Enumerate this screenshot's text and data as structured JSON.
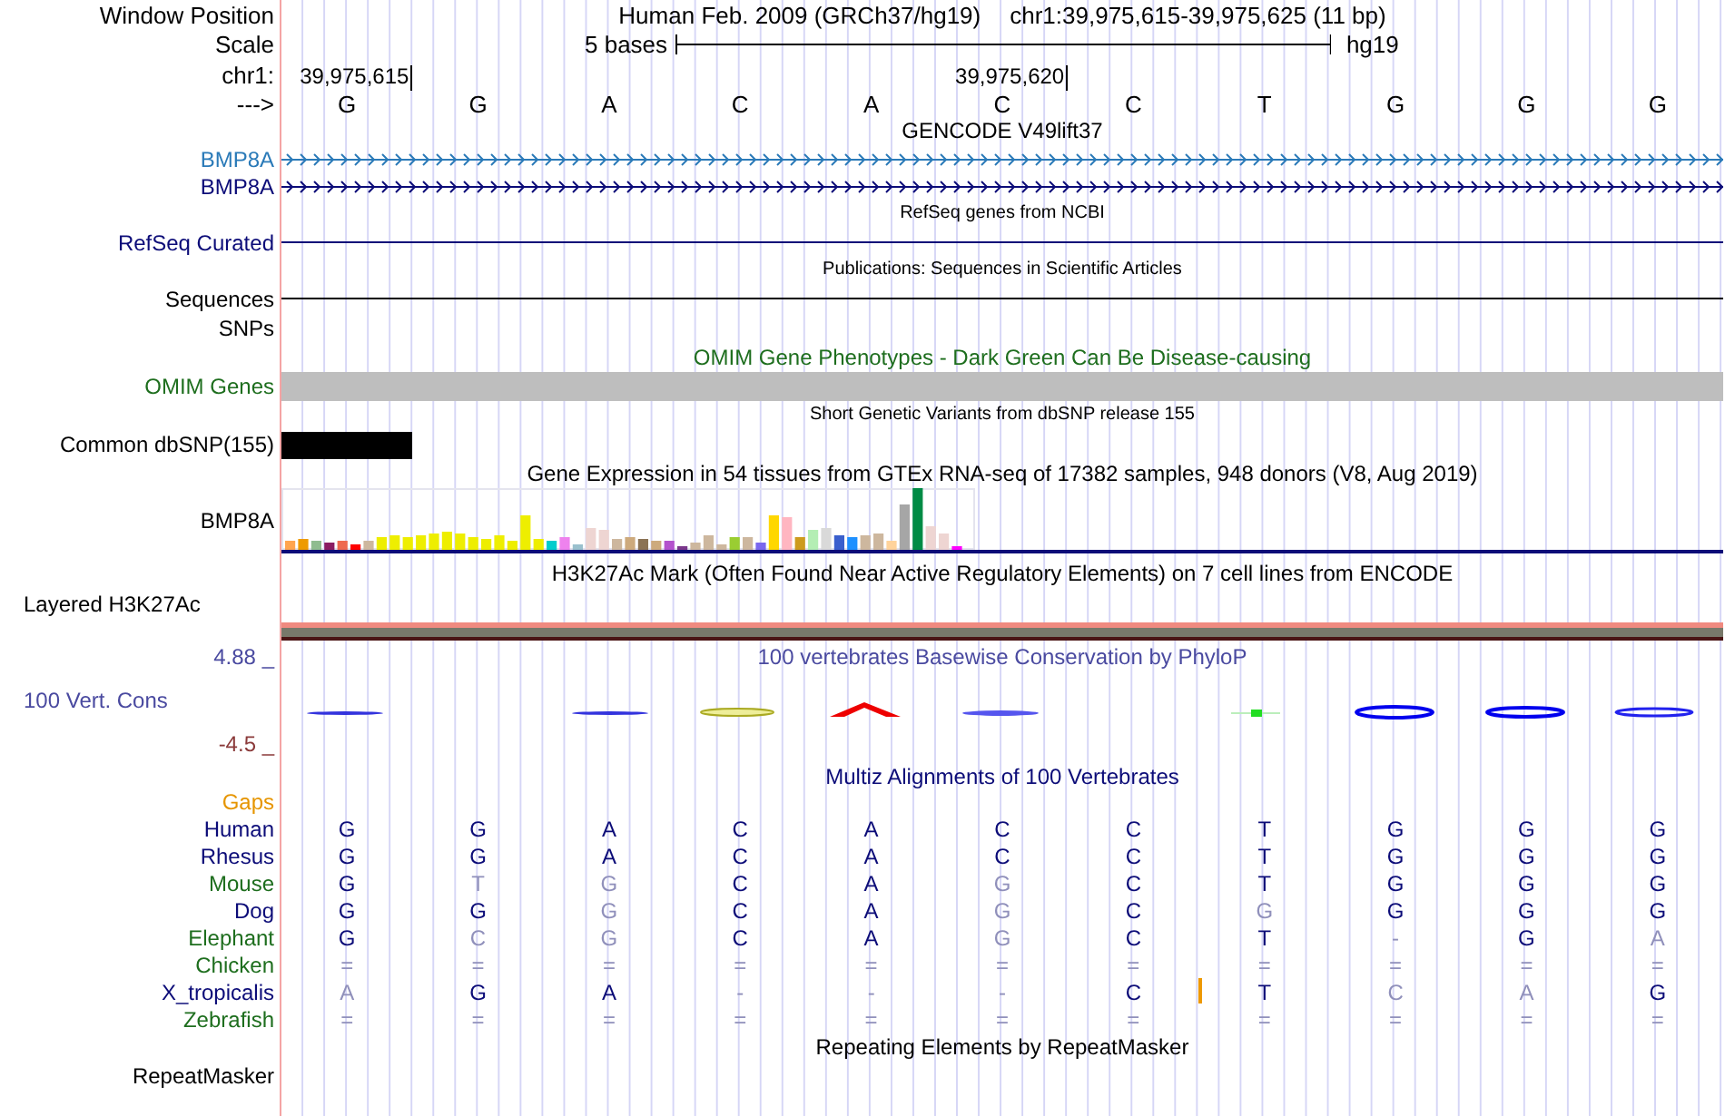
{
  "header": {
    "label": "Window Position",
    "assembly": "Human Feb. 2009 (GRCh37/hg19)",
    "position": "chr1:39,975,615-39,975,625 (11 bp)"
  },
  "scale": {
    "label": "Scale",
    "span": "5 bases",
    "db": "hg19"
  },
  "coordinates": {
    "label": "chr1:",
    "ticks": [
      "39,975,615",
      "39,975,620"
    ]
  },
  "sequence": {
    "label": "--->",
    "bases": [
      "G",
      "G",
      "A",
      "C",
      "A",
      "C",
      "C",
      "T",
      "G",
      "G",
      "G"
    ]
  },
  "tracks": [
    {
      "kind": "genes",
      "title": "GENCODE V49lift37",
      "rows": [
        {
          "label": "BMP8A",
          "color": "#2a7ab8"
        },
        {
          "label": "BMP8A",
          "color": "#0c0c78"
        }
      ]
    },
    {
      "kind": "line",
      "title": "RefSeq genes from NCBI",
      "label": "RefSeq Curated",
      "color": "#0c0c78"
    },
    {
      "kind": "line",
      "title": "Publications: Sequences in Scientific Articles",
      "label": "Sequences",
      "color": "#000000"
    },
    {
      "kind": "empty",
      "label": "SNPs",
      "color": "#000000"
    },
    {
      "kind": "full-bar",
      "title": "OMIM Gene Phenotypes - Dark Green Can Be Disease-causing",
      "label": "OMIM Genes",
      "color": "#1e6e1e"
    },
    {
      "kind": "snp",
      "title": "Short Genetic Variants from dbSNP release 155",
      "label": "Common dbSNP(155)",
      "color": "#000000"
    },
    {
      "kind": "expression",
      "title": "Gene Expression in 54 tissues from GTEx RNA-seq of 17382 samples, 948 donors (V8, Aug 2019)",
      "label": "BMP8A",
      "color": "#000000"
    },
    {
      "kind": "layered",
      "title": "H3K27Ac Mark (Often Found Near Active Regulatory Elements) on 7 cell lines from ENCODE",
      "label": "Layered H3K27Ac",
      "color": "#000000"
    },
    {
      "kind": "conservation",
      "title": "100 vertebrates Basewise Conservation by PhyloP",
      "label": "100 Vert. Cons",
      "max": "4.88 _",
      "min": "-4.5 _",
      "color": "#4a4aa0"
    },
    {
      "kind": "multiz",
      "title": "Multiz Alignments of 100 Vertebrates",
      "gaps_label": "Gaps",
      "color": "#0c0c78",
      "species": [
        {
          "name": "Human",
          "color": "#0c0c78",
          "bases": [
            {
              "base": "G",
              "faded": false,
              "insertion": false
            },
            {
              "base": "G",
              "faded": false,
              "insertion": false
            },
            {
              "base": "A",
              "faded": false,
              "insertion": false
            },
            {
              "base": "C",
              "faded": false,
              "insertion": false
            },
            {
              "base": "A",
              "faded": false,
              "insertion": false
            },
            {
              "base": "C",
              "faded": false,
              "insertion": false
            },
            {
              "base": "C",
              "faded": false,
              "insertion": false
            },
            {
              "base": "T",
              "faded": false,
              "insertion": false
            },
            {
              "base": "G",
              "faded": false,
              "insertion": false
            },
            {
              "base": "G",
              "faded": false,
              "insertion": false
            },
            {
              "base": "G",
              "faded": false,
              "insertion": false
            }
          ]
        },
        {
          "name": "Rhesus",
          "color": "#0c0c78",
          "bases": [
            {
              "base": "G",
              "faded": false,
              "insertion": false
            },
            {
              "base": "G",
              "faded": false,
              "insertion": false
            },
            {
              "base": "A",
              "faded": false,
              "insertion": false
            },
            {
              "base": "C",
              "faded": false,
              "insertion": false
            },
            {
              "base": "A",
              "faded": false,
              "insertion": false
            },
            {
              "base": "C",
              "faded": false,
              "insertion": false
            },
            {
              "base": "C",
              "faded": false,
              "insertion": false
            },
            {
              "base": "T",
              "faded": false,
              "insertion": false
            },
            {
              "base": "G",
              "faded": false,
              "insertion": false
            },
            {
              "base": "G",
              "faded": false,
              "insertion": false
            },
            {
              "base": "G",
              "faded": false,
              "insertion": false
            }
          ]
        },
        {
          "name": "Mouse",
          "color": "#1e6e1e",
          "bases": [
            {
              "base": "G",
              "faded": false,
              "insertion": false
            },
            {
              "base": "T",
              "faded": true,
              "insertion": false
            },
            {
              "base": "G",
              "faded": true,
              "insertion": false
            },
            {
              "base": "C",
              "faded": false,
              "insertion": false
            },
            {
              "base": "A",
              "faded": false,
              "insertion": false
            },
            {
              "base": "G",
              "faded": true,
              "insertion": false
            },
            {
              "base": "C",
              "faded": false,
              "insertion": false
            },
            {
              "base": "T",
              "faded": false,
              "insertion": false
            },
            {
              "base": "G",
              "faded": false,
              "insertion": false
            },
            {
              "base": "G",
              "faded": false,
              "insertion": false
            },
            {
              "base": "G",
              "faded": false,
              "insertion": false
            }
          ]
        },
        {
          "name": "Dog",
          "color": "#0c0c78",
          "bases": [
            {
              "base": "G",
              "faded": false,
              "insertion": false
            },
            {
              "base": "G",
              "faded": false,
              "insertion": false
            },
            {
              "base": "G",
              "faded": true,
              "insertion": false
            },
            {
              "base": "C",
              "faded": false,
              "insertion": false
            },
            {
              "base": "A",
              "faded": false,
              "insertion": false
            },
            {
              "base": "G",
              "faded": true,
              "insertion": false
            },
            {
              "base": "C",
              "faded": false,
              "insertion": false
            },
            {
              "base": "G",
              "faded": true,
              "insertion": false
            },
            {
              "base": "G",
              "faded": false,
              "insertion": false
            },
            {
              "base": "G",
              "faded": false,
              "insertion": false
            },
            {
              "base": "G",
              "faded": false,
              "insertion": false
            }
          ]
        },
        {
          "name": "Elephant",
          "color": "#1e6e1e",
          "bases": [
            {
              "base": "G",
              "faded": false,
              "insertion": false
            },
            {
              "base": "C",
              "faded": true,
              "insertion": false
            },
            {
              "base": "G",
              "faded": true,
              "insertion": false
            },
            {
              "base": "C",
              "faded": false,
              "insertion": false
            },
            {
              "base": "A",
              "faded": false,
              "insertion": false
            },
            {
              "base": "G",
              "faded": true,
              "insertion": false
            },
            {
              "base": "C",
              "faded": false,
              "insertion": false
            },
            {
              "base": "T",
              "faded": false,
              "insertion": false
            },
            {
              "base": "-",
              "faded": true,
              "insertion": false
            },
            {
              "base": "G",
              "faded": false,
              "insertion": false
            },
            {
              "base": "A",
              "faded": true,
              "insertion": false
            }
          ]
        },
        {
          "name": "Chicken",
          "color": "#1e6e1e",
          "bases": [
            {
              "base": "=",
              "faded": true,
              "insertion": false
            },
            {
              "base": "=",
              "faded": true,
              "insertion": false
            },
            {
              "base": "=",
              "faded": true,
              "insertion": false
            },
            {
              "base": "=",
              "faded": true,
              "insertion": false
            },
            {
              "base": "=",
              "faded": true,
              "insertion": false
            },
            {
              "base": "=",
              "faded": true,
              "insertion": false
            },
            {
              "base": "=",
              "faded": true,
              "insertion": false
            },
            {
              "base": "=",
              "faded": true,
              "insertion": false
            },
            {
              "base": "=",
              "faded": true,
              "insertion": false
            },
            {
              "base": "=",
              "faded": true,
              "insertion": false
            },
            {
              "base": "=",
              "faded": true,
              "insertion": false
            }
          ]
        },
        {
          "name": "X_tropicalis",
          "color": "#0c0c78",
          "bases": [
            {
              "base": "A",
              "faded": true,
              "insertion": false
            },
            {
              "base": "G",
              "faded": false,
              "insertion": false
            },
            {
              "base": "A",
              "faded": false,
              "insertion": false
            },
            {
              "base": "-",
              "faded": true,
              "insertion": false
            },
            {
              "base": "-",
              "faded": true,
              "insertion": false
            },
            {
              "base": "-",
              "faded": true,
              "insertion": false
            },
            {
              "base": "C",
              "faded": false,
              "insertion": true
            },
            {
              "base": "T",
              "faded": false,
              "insertion": false
            },
            {
              "base": "C",
              "faded": true,
              "insertion": false
            },
            {
              "base": "A",
              "faded": true,
              "insertion": false
            },
            {
              "base": "G",
              "faded": false,
              "insertion": false
            }
          ]
        },
        {
          "name": "Zebrafish",
          "color": "#1e6e1e",
          "bases": [
            {
              "base": "=",
              "faded": true,
              "insertion": false
            },
            {
              "base": "=",
              "faded": true,
              "insertion": false
            },
            {
              "base": "=",
              "faded": true,
              "insertion": false
            },
            {
              "base": "=",
              "faded": true,
              "insertion": false
            },
            {
              "base": "=",
              "faded": true,
              "insertion": false
            },
            {
              "base": "=",
              "faded": true,
              "insertion": false
            },
            {
              "base": "=",
              "faded": true,
              "insertion": false
            },
            {
              "base": "=",
              "faded": true,
              "insertion": false
            },
            {
              "base": "=",
              "faded": true,
              "insertion": false
            },
            {
              "base": "=",
              "faded": true,
              "insertion": false
            },
            {
              "base": "=",
              "faded": true,
              "insertion": false
            }
          ]
        }
      ]
    },
    {
      "kind": "titled-empty",
      "title": "Repeating Elements by RepeatMasker",
      "label": "RepeatMasker",
      "color": "#000000"
    }
  ]
}
